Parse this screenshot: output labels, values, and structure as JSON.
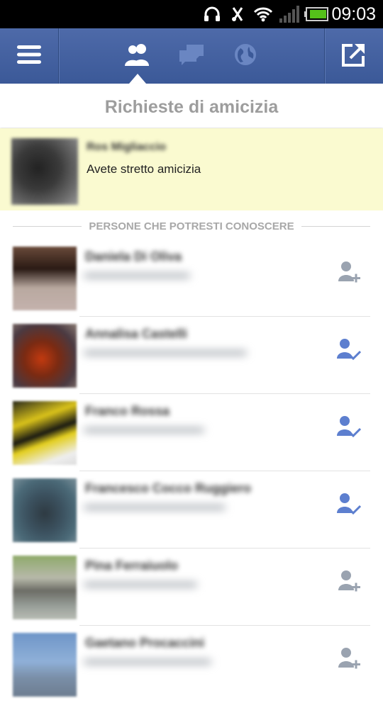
{
  "status_bar": {
    "time": "09:03",
    "icons": [
      "headphones-icon",
      "vibrate-off-icon",
      "wifi-icon",
      "signal-icon",
      "battery-icon"
    ]
  },
  "toolbar": {
    "menu_icon": "menu-icon",
    "tabs": [
      {
        "name": "friends-tab",
        "icon": "friends-icon",
        "active": true
      },
      {
        "name": "messages-tab",
        "icon": "messages-icon",
        "active": false
      },
      {
        "name": "notifications-tab",
        "icon": "globe-icon",
        "active": false
      }
    ],
    "publish_icon": "publish-icon",
    "colors": {
      "bar": "#3b5998",
      "active_icon": "#ffffff",
      "inactive_icon": "#6a86c2"
    }
  },
  "panel": {
    "title": "Richieste di amicizia"
  },
  "request": {
    "name": "Ros Migliaccio",
    "status": "Avete stretto amicizia",
    "highlight_color": "#fafad0"
  },
  "suggestions": {
    "header": "PERSONE CHE POTRESTI CONOSCERE",
    "people": [
      {
        "name": "Daniela Di Oliva",
        "subtitle": "",
        "action": "add-friend-icon",
        "requested": false
      },
      {
        "name": "Annalisa Castelli",
        "subtitle": "",
        "action": "request-sent-icon",
        "requested": true
      },
      {
        "name": "Franco Rossa",
        "subtitle": "",
        "action": "request-sent-icon",
        "requested": true
      },
      {
        "name": "Francesco Cocco Ruggiero",
        "subtitle": "",
        "action": "request-sent-icon",
        "requested": true
      },
      {
        "name": "Pina Ferraiuolo",
        "subtitle": "",
        "action": "add-friend-icon",
        "requested": false
      },
      {
        "name": "Gaetano Procaccini",
        "subtitle": "",
        "action": "add-friend-icon",
        "requested": false
      }
    ],
    "colors": {
      "add": "#9aa3b0",
      "requested": "#5d7fcf"
    }
  }
}
